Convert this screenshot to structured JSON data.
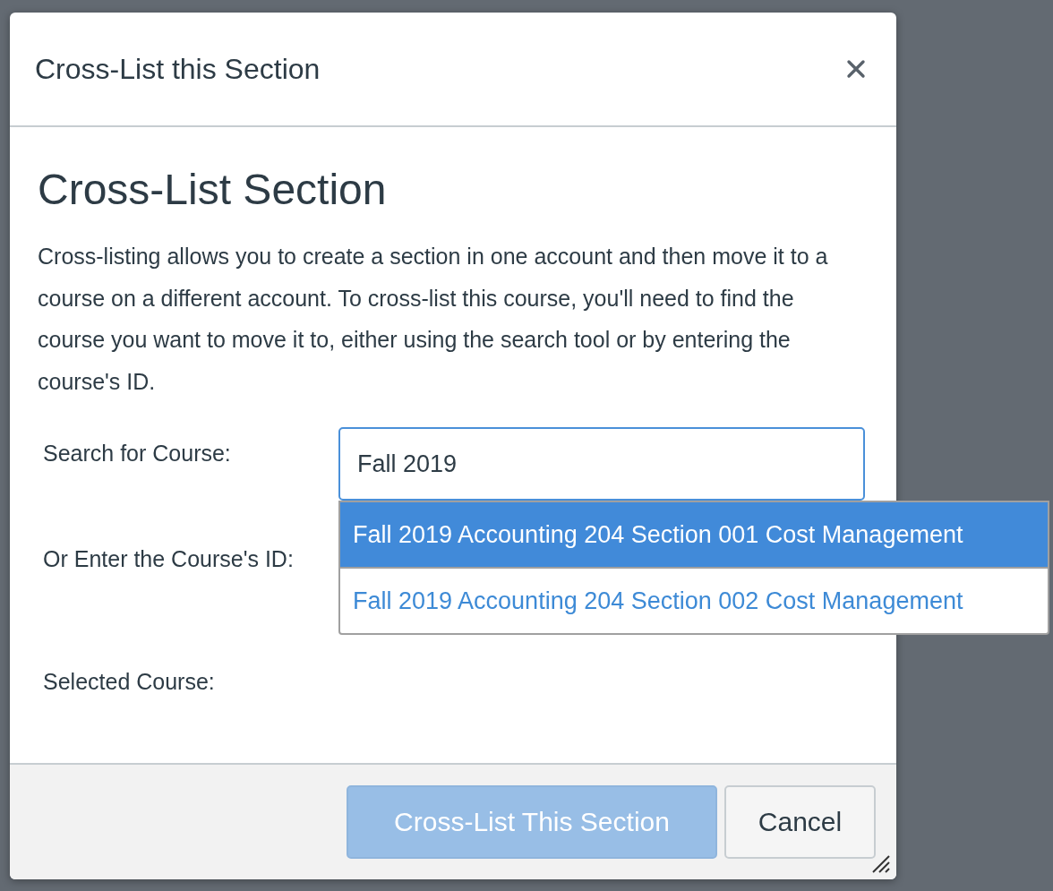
{
  "dialog": {
    "title": "Cross-List this Section"
  },
  "heading": "Cross-List Section",
  "description": "Cross-listing allows you to create a section in one account and then move it to a course on a different account. To cross-list this course, you'll need to find the course you want to move it to, either using the search tool or by entering the course's ID.",
  "form": {
    "search_label": "Search for Course:",
    "search_value": "Fall 2019",
    "id_label": "Or Enter the Course's ID:",
    "selected_label": "Selected Course:"
  },
  "results": [
    {
      "label": "Fall 2019 Accounting 204 Section 001 Cost Management",
      "selected": true
    },
    {
      "label": "Fall 2019 Accounting 204 Section 002 Cost Management",
      "selected": false
    }
  ],
  "buttons": [
    {
      "label": "Cross-List This Section",
      "kind": "primary",
      "disabled": true
    },
    {
      "label": "Cancel",
      "kind": "secondary",
      "disabled": false
    }
  ]
}
